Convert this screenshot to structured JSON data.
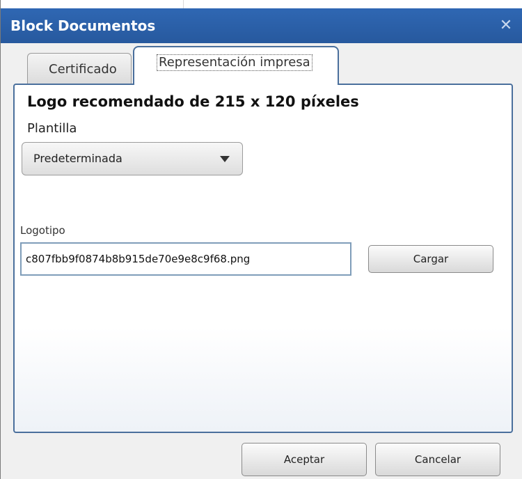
{
  "window": {
    "title": "Block Documentos",
    "close_glyph": "✕"
  },
  "tabs": [
    {
      "label": "Certificado",
      "active": false
    },
    {
      "label": "Representación impresa",
      "active": true
    }
  ],
  "panel": {
    "heading": "Logo recomendado de 215 x 120 píxeles",
    "template_label": "Plantilla",
    "template_selected": "Predeterminada",
    "logo_label": "Logotipo",
    "logo_value": "c807fbb9f0874b8b915de70e9e8c9f68.png",
    "upload_button": "Cargar"
  },
  "footer": {
    "accept_button": "Aceptar",
    "cancel_button": "Cancelar"
  },
  "colors": {
    "title_bar": "#2f67b3",
    "panel_border": "#4a6f9c"
  }
}
